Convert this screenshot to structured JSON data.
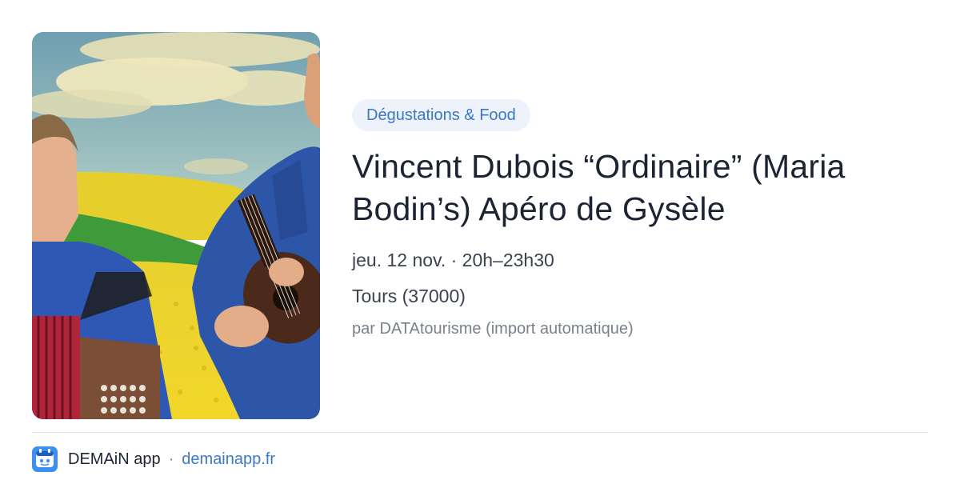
{
  "event": {
    "image_alt": "Deux musiciens avec accordéon et ukulélé devant un champ de colza",
    "category": "Dégustations & Food",
    "title": "Vincent Dubois “Ordinaire” (Maria Bodin’s) Apéro de Gysèle",
    "date": "jeu. 12 nov. · 20h–23h30",
    "location": "Tours (37000)",
    "source": "par DATAtourisme (import automatique)"
  },
  "footer": {
    "app_name": "DEMAiN app",
    "separator": "·",
    "url": "demainapp.fr",
    "logo_icon": "demain-logo-icon"
  },
  "colors": {
    "accent": "#3a78c9",
    "badge_bg": "#eef3fb",
    "title": "#1c2433",
    "muted": "#7a808b"
  }
}
